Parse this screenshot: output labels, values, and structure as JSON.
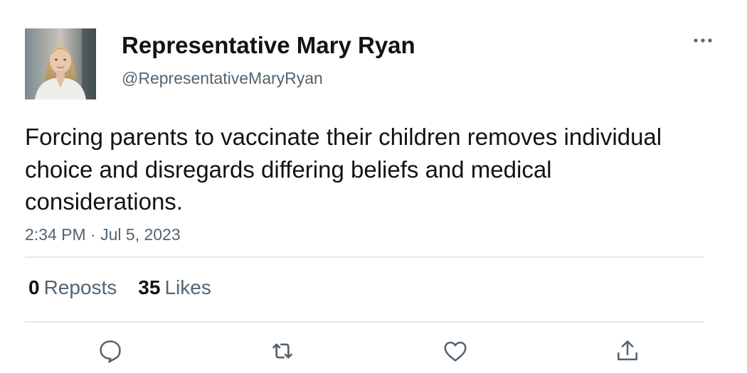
{
  "user": {
    "display_name": "Representative Mary Ryan",
    "handle": "@RepresentativeMaryRyan"
  },
  "tweet": {
    "text": "Forcing parents to vaccinate their children removes individual choice and disregards differing beliefs and medical considerations.",
    "time": "2:34 PM",
    "separator": "·",
    "date": "Jul 5, 2023"
  },
  "stats": {
    "reposts_count": "0",
    "reposts_label": "Reposts",
    "likes_count": "35",
    "likes_label": "Likes"
  },
  "icons": {
    "more": "more-horizontal-icon",
    "reply": "reply-icon",
    "repost": "repost-icon",
    "like": "heart-icon",
    "share": "share-icon"
  },
  "colors": {
    "text_primary": "#0f1419",
    "text_secondary": "#536471",
    "divider": "#e1e8ed"
  }
}
